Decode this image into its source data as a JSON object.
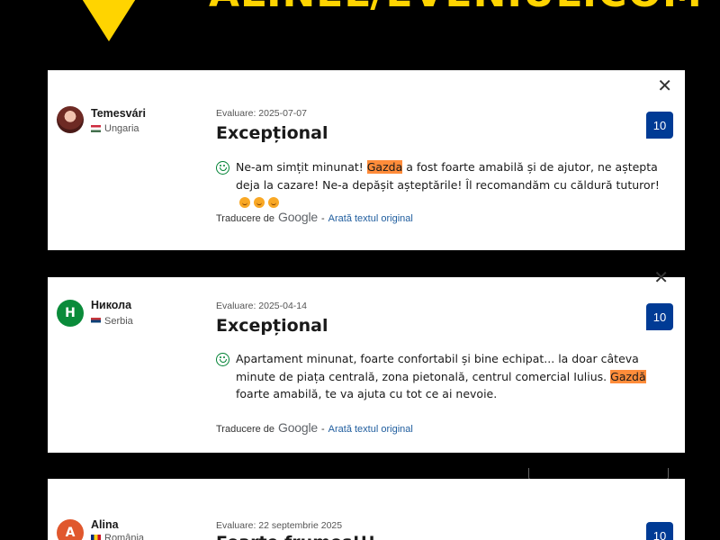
{
  "banner": {
    "text": "ALINEL/EVENIUL.COM"
  },
  "reviews": [
    {
      "name": "Temesvári",
      "country": "Ungaria",
      "date": "Evaluare: 2025-07-07",
      "headline": "Excepțional",
      "score": "10",
      "text_before": "Ne-am simțit minunat! ",
      "highlight": "Gazda",
      "text_after": " a fost foarte amabilă și de ajutor, ne aștepta deja la cazare! Ne-a depășit așteptările! Îl recomandăm cu căldură tuturor!",
      "translated_by": "Traducere de",
      "google": "Google",
      "separator": "-",
      "show_original": "Arată textul original"
    },
    {
      "name": "Никола",
      "avatar_letter": "H",
      "country": "Serbia",
      "date": "Evaluare: 2025-04-14",
      "headline": "Excepțional",
      "score": "10",
      "text_before": "Apartament minunat, foarte confortabil și bine echipat... la doar câteva minute de piața centrală, zona pietonală, centrul comercial Iulius. ",
      "highlight": "Gazdă",
      "text_after": " foarte amabilă, te va ajuta cu tot ce ai nevoie.",
      "translated_by": "Traducere de",
      "google": "Google",
      "separator": "-",
      "show_original": "Arată textul original"
    },
    {
      "name": "Alina",
      "avatar_letter": "A",
      "country": "România",
      "date": "Evaluare: 22 septembrie 2025",
      "headline": "Foarte frumos!!!",
      "score": "10"
    }
  ],
  "colors": {
    "score_bg": "#003b95",
    "highlight": "#ff8c3a",
    "banner": "#ffd400"
  }
}
